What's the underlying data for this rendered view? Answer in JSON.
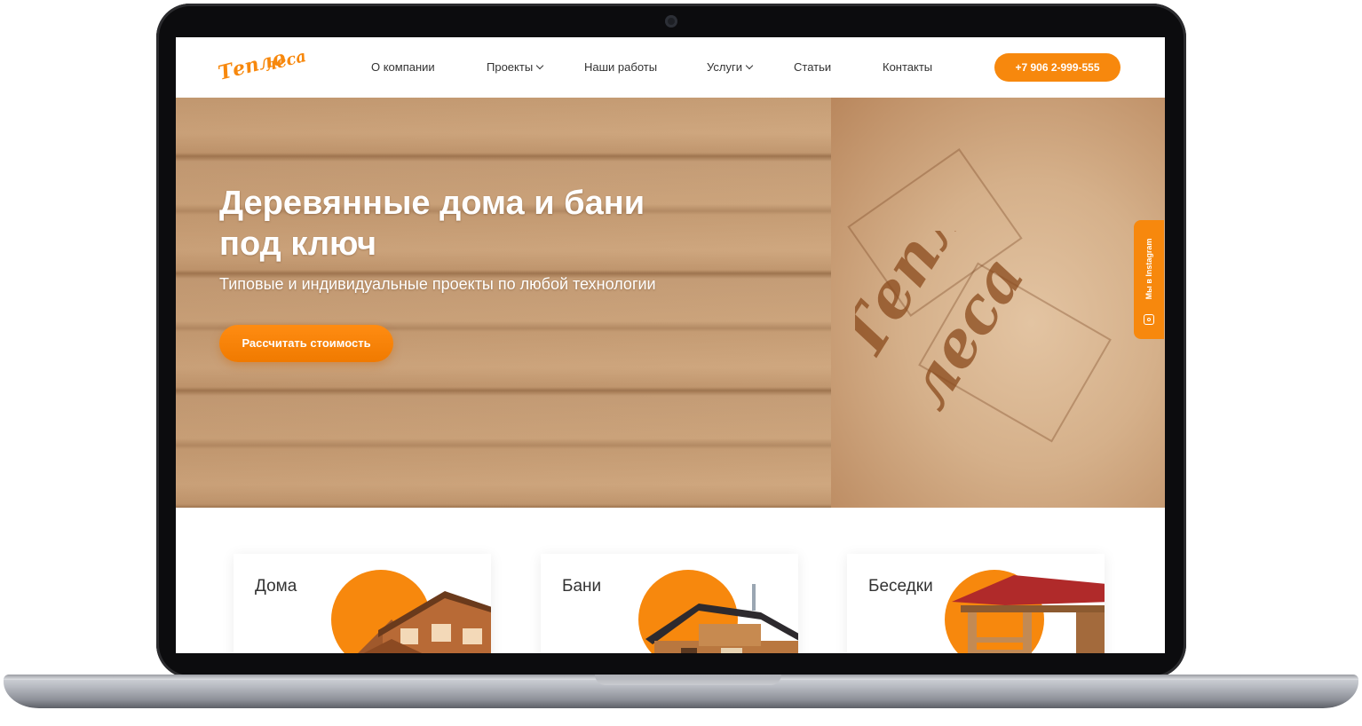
{
  "site": {
    "logo_text_line1": "Тепло",
    "logo_text_line2": "леса"
  },
  "nav": {
    "items": [
      {
        "label": "О компании",
        "has_dropdown": false
      },
      {
        "label": "Проекты",
        "has_dropdown": true
      },
      {
        "label": "Наши работы",
        "has_dropdown": false
      },
      {
        "label": "Услуги",
        "has_dropdown": true
      },
      {
        "label": "Статьи",
        "has_dropdown": false
      },
      {
        "label": "Контакты",
        "has_dropdown": false
      }
    ],
    "phone": "+7 906 2-999-555"
  },
  "hero": {
    "title_line1": "Деревянные дома и бани",
    "title_line2": "под ключ",
    "subtitle": "Типовые и индивидуальные проекты по любой технологии",
    "cta_label": "Рассчитать стоимость"
  },
  "side_tab": {
    "label": "Мы в Instagram"
  },
  "cards": [
    {
      "title": "Дома"
    },
    {
      "title": "Бани"
    },
    {
      "title": "Беседки"
    }
  ],
  "colors": {
    "accent": "#f7880d",
    "wood": "#c8a078",
    "text_dark": "#333333"
  }
}
